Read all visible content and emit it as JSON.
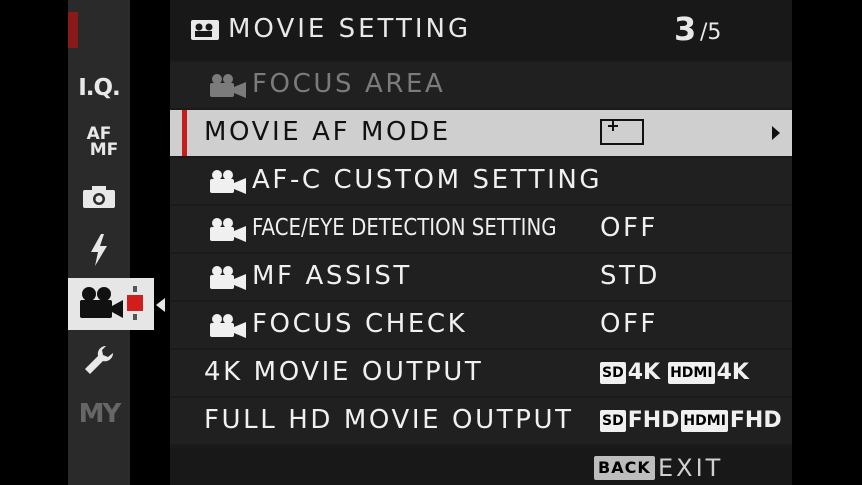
{
  "header": {
    "title": "MOVIE SETTING",
    "page_current": "3",
    "page_total": "/5"
  },
  "sidebar": {
    "tabs": [
      {
        "id": "iq",
        "label": "I.Q."
      },
      {
        "id": "afmf",
        "label_top": "AF",
        "label_bottom": "MF"
      },
      {
        "id": "camera",
        "icon": "camera-icon"
      },
      {
        "id": "flash",
        "icon": "flash-icon"
      },
      {
        "id": "movie",
        "icon": "movie-camera-icon",
        "active": true
      },
      {
        "id": "setup",
        "icon": "wrench-icon"
      },
      {
        "id": "my",
        "label": "MY"
      }
    ]
  },
  "menu": {
    "items": [
      {
        "label": "FOCUS AREA",
        "icon": "movie-camera-icon",
        "value": "",
        "disabled": true
      },
      {
        "label": "MOVIE AF MODE",
        "value_icon": "af-area-icon",
        "selected": true
      },
      {
        "label": "AF-C CUSTOM SETTING",
        "icon": "movie-camera-icon",
        "value": ""
      },
      {
        "label": "FACE/EYE DETECTION SETTING",
        "icon": "movie-camera-icon",
        "value": "OFF"
      },
      {
        "label": "MF ASSIST",
        "icon": "movie-camera-icon",
        "value": "STD"
      },
      {
        "label": "FOCUS CHECK",
        "icon": "movie-camera-icon",
        "value": "OFF"
      },
      {
        "label": "4K MOVIE OUTPUT",
        "value_sd": "SD",
        "value_sd_res": "4K",
        "value_hdmi": "HDMI",
        "value_hdmi_res": "4K"
      },
      {
        "label": "FULL HD MOVIE OUTPUT",
        "value_sd": "SD",
        "value_sd_res": "FHD",
        "value_hdmi": "HDMI",
        "value_hdmi_res": "FHD"
      }
    ]
  },
  "footer": {
    "back": "BACK",
    "exit": "EXIT"
  },
  "colors": {
    "accent": "#c41e1e",
    "selected_bg": "#cfcfcf",
    "panel_bg": "#1a1a1a",
    "disabled_text": "#7b7b7b"
  }
}
